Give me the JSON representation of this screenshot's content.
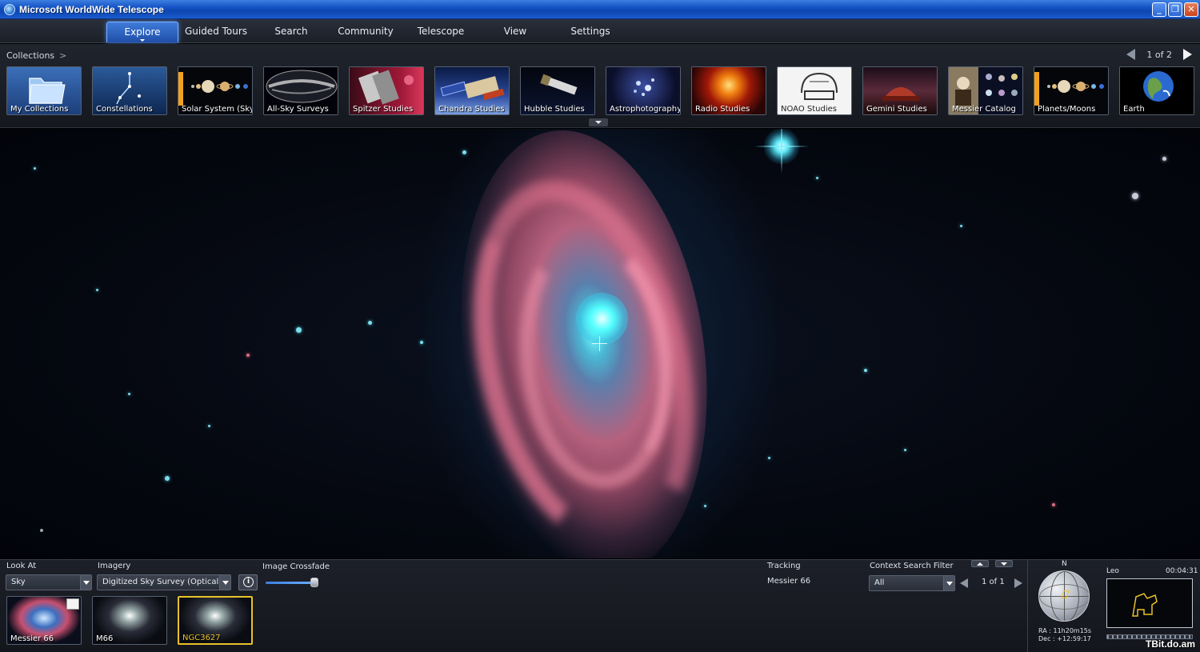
{
  "window": {
    "title": "Microsoft WorldWide Telescope"
  },
  "menu": {
    "tabs": [
      {
        "label": "Explore"
      },
      {
        "label": "Guided Tours"
      },
      {
        "label": "Search"
      },
      {
        "label": "Community"
      },
      {
        "label": "Telescope"
      },
      {
        "label": "View"
      },
      {
        "label": "Settings"
      }
    ]
  },
  "collections": {
    "breadcrumb": "Collections",
    "breadcrumb_sep": ">",
    "pager": "1 of 2",
    "items": [
      {
        "label": "My Collections"
      },
      {
        "label": "Constellations"
      },
      {
        "label": "Solar System (Sky)"
      },
      {
        "label": "All-Sky Surveys"
      },
      {
        "label": "Spitzer Studies"
      },
      {
        "label": "Chandra Studies"
      },
      {
        "label": "Hubble Studies"
      },
      {
        "label": "Astrophotography"
      },
      {
        "label": "Radio Studies"
      },
      {
        "label": "NOAO Studies"
      },
      {
        "label": "Gemini Studies"
      },
      {
        "label": "Messier Catalog"
      },
      {
        "label": "Planets/Moons"
      },
      {
        "label": "Earth"
      }
    ]
  },
  "bottom": {
    "look_at_label": "Look At",
    "look_at_value": "Sky",
    "imagery_label": "Imagery",
    "imagery_value": "Digitized Sky Survey (Optical...",
    "crossfade_label": "Image Crossfade",
    "crossfade_value": 0.9,
    "tracking_label": "Tracking",
    "tracking_value": "Messier 66",
    "context_filter_label": "Context Search Filter",
    "context_filter_value": "All",
    "context_pager": "1 of 1",
    "context_items": [
      {
        "label": "Messier 66"
      },
      {
        "label": "M66"
      },
      {
        "label": "NGC3627"
      }
    ],
    "compass_north": "N",
    "ra": "RA :  11h20m15s",
    "dec": "Dec : +12:59:17",
    "constellation": "Leo",
    "clock": "00:04:31"
  },
  "watermark": "TBit.do.am",
  "colors": {
    "accent": "#2f6fd6",
    "selection": "#e8c22a",
    "titlebar": "#1553c5"
  }
}
